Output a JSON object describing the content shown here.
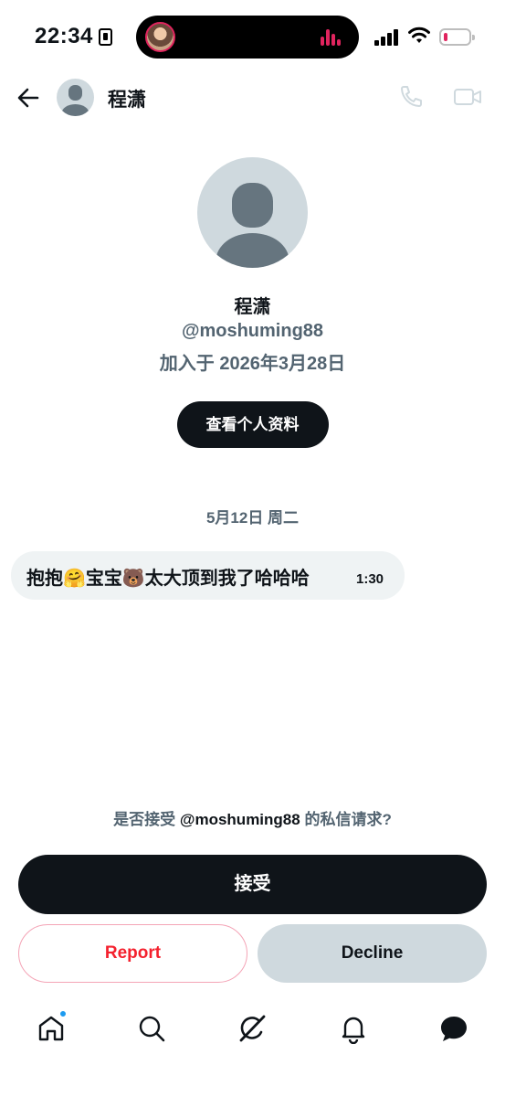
{
  "status_bar": {
    "time": "22:34",
    "battery_level": 0.15,
    "battery_color": "#e0245e"
  },
  "header": {
    "contact_name": "程潇",
    "icons": [
      "back-arrow-icon",
      "phone-icon",
      "video-camera-icon"
    ]
  },
  "profile": {
    "name": "程潇",
    "handle": "@moshuming88",
    "joined": "加入于 2026年3月28日",
    "view_profile_label": "查看个人资料"
  },
  "chat": {
    "date_separator": "5月12日 周二",
    "messages": [
      {
        "text": "抱抱🤗宝宝🐻太大顶到我了哈哈哈",
        "time": "1:30",
        "direction": "incoming"
      }
    ]
  },
  "request": {
    "prompt_prefix": "是否接受 ",
    "prompt_handle": "@moshuming88",
    "prompt_suffix": " 的私信请求?",
    "accept_label": "接受",
    "report_label": "Report",
    "decline_label": "Decline"
  },
  "bottom_nav": {
    "items": [
      "home-icon",
      "search-icon",
      "grok-icon",
      "notifications-icon",
      "messages-icon"
    ],
    "home_has_notification_dot": true
  },
  "colors": {
    "primary_text": "#0f1419",
    "secondary_text": "#536471",
    "report_red": "#f4212e",
    "notification_blue": "#1d9bf0"
  }
}
